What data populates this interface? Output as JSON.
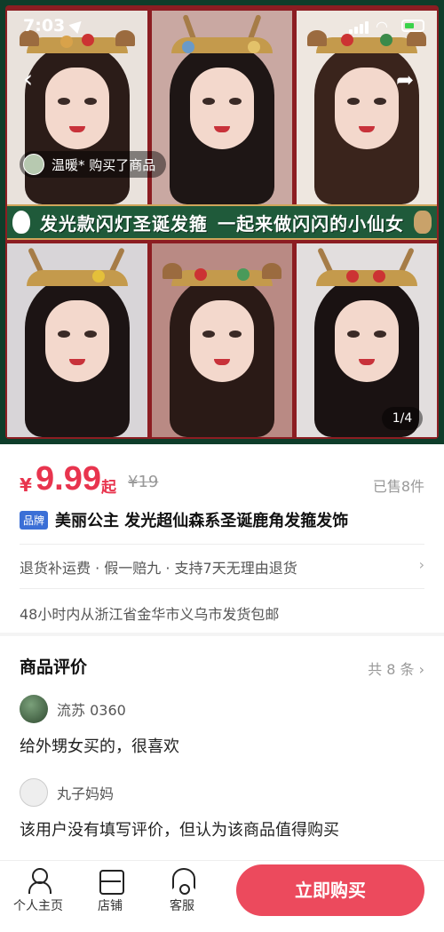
{
  "status_bar": {
    "time": "7:03"
  },
  "hero": {
    "banner_left": "发光款闪灯圣诞发箍",
    "banner_right": "一起来做闪闪的小仙女",
    "buyer_toast": "温暖* 购买了商品",
    "image_counter": "1/4"
  },
  "product": {
    "currency": "¥",
    "price": "9.99",
    "price_suffix": "起",
    "original_price": "¥19",
    "sold": "已售8件",
    "brand_tag": "品牌",
    "title": "美丽公主 发光超仙森系圣诞鹿角发箍发饰",
    "services": "退货补运费 · 假一赔九 · 支持7天无理由退货",
    "shipping": "48小时内从浙江省金华市义乌市发货包邮"
  },
  "reviews": {
    "heading": "商品评价",
    "count": "共 8 条",
    "items": [
      {
        "user": "流苏 0360",
        "text": "给外甥女买的，很喜欢"
      },
      {
        "user": "丸子妈妈",
        "text": "该用户没有填写评价，但认为该商品值得购买"
      }
    ]
  },
  "bottom_bar": {
    "profile": "个人主页",
    "shop": "店铺",
    "service": "客服",
    "buy": "立即购买"
  },
  "colors": {
    "accent": "#ec4a5d",
    "price": "#e8344e",
    "brand_tag": "#3b6fd6"
  }
}
